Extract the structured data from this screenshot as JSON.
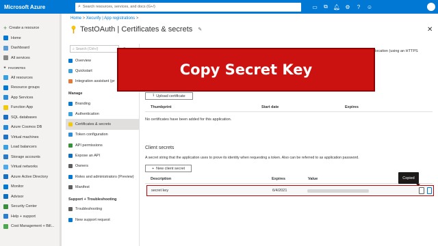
{
  "topbar": {
    "brand": "Microsoft Azure",
    "search_placeholder": "Search resources, services, and docs (G+/)",
    "notification_count": "1"
  },
  "leftnav": {
    "create": "Create a resource",
    "items_top": [
      "Home",
      "Dashboard",
      "All services"
    ],
    "favorites_label": "FAVORITES",
    "favorites": [
      {
        "label": "All resources",
        "color": "#3aa0e0"
      },
      {
        "label": "Resource groups",
        "color": "#0078d4"
      },
      {
        "label": "App Services",
        "color": "#2e8bd6"
      },
      {
        "label": "Function App",
        "color": "#f2c811"
      },
      {
        "label": "SQL databases",
        "color": "#1c6fc4"
      },
      {
        "label": "Azure Cosmos DB",
        "color": "#2a88d8"
      },
      {
        "label": "Virtual machines",
        "color": "#2072c6"
      },
      {
        "label": "Load balancers",
        "color": "#3aa0e0"
      },
      {
        "label": "Storage accounts",
        "color": "#2b7ac4"
      },
      {
        "label": "Virtual networks",
        "color": "#50aaea"
      },
      {
        "label": "Azure Active Directory",
        "color": "#1a6fbf"
      },
      {
        "label": "Monitor",
        "color": "#0078d4"
      },
      {
        "label": "Advisor",
        "color": "#0e6fc2"
      },
      {
        "label": "Security Center",
        "color": "#3b8e3b"
      },
      {
        "label": "Help + support",
        "color": "#2c7dd0"
      },
      {
        "label": "Cost Management + Bill...",
        "color": "#4fa64f"
      }
    ]
  },
  "breadcrumb": {
    "home": "Home",
    "sep": ">",
    "second": "Xecurify | App registrations",
    "end": ">"
  },
  "page": {
    "title": "TestOAuth | Certificates & secrets"
  },
  "resmenu": {
    "search_placeholder": "Search (Ctrl+/)",
    "collapse": "«",
    "top_items": [
      "Overview",
      "Quickstart",
      "Integration assistant (pr"
    ],
    "manage_label": "Manage",
    "manage_items": [
      {
        "label": "Branding",
        "active": false
      },
      {
        "label": "Authentication",
        "active": false
      },
      {
        "label": "Certificates & secrets",
        "active": true
      },
      {
        "label": "Token configuration",
        "active": false
      },
      {
        "label": "API permissions",
        "active": false
      },
      {
        "label": "Expose an API",
        "active": false
      },
      {
        "label": "Owners",
        "active": false
      },
      {
        "label": "Roles and administrators (Preview)",
        "active": false
      },
      {
        "label": "Manifest",
        "active": false
      }
    ],
    "support_label": "Support + Troubleshooting",
    "support_items": [
      "Troubleshooting",
      "New support request"
    ]
  },
  "content": {
    "bg_text": "location (using an HTTPS",
    "upload_label": "Upload certificate",
    "cert_headers": [
      "Thumbprint",
      "Start date",
      "Expires"
    ],
    "no_certs": "No certificates have been added for this application.",
    "client_secrets_title": "Client secrets",
    "client_secrets_desc": "A secret string that the application uses to prove its identity when requesting a token. Also can be referred to as application password.",
    "new_secret_label": "New client secret",
    "secret_headers": [
      "Description",
      "Expires",
      "Value"
    ],
    "secret_row": {
      "description": "secret key",
      "expires": "6/4/2021"
    },
    "tooltip": "Copied"
  },
  "banner": {
    "text": "Copy Secret Key"
  }
}
